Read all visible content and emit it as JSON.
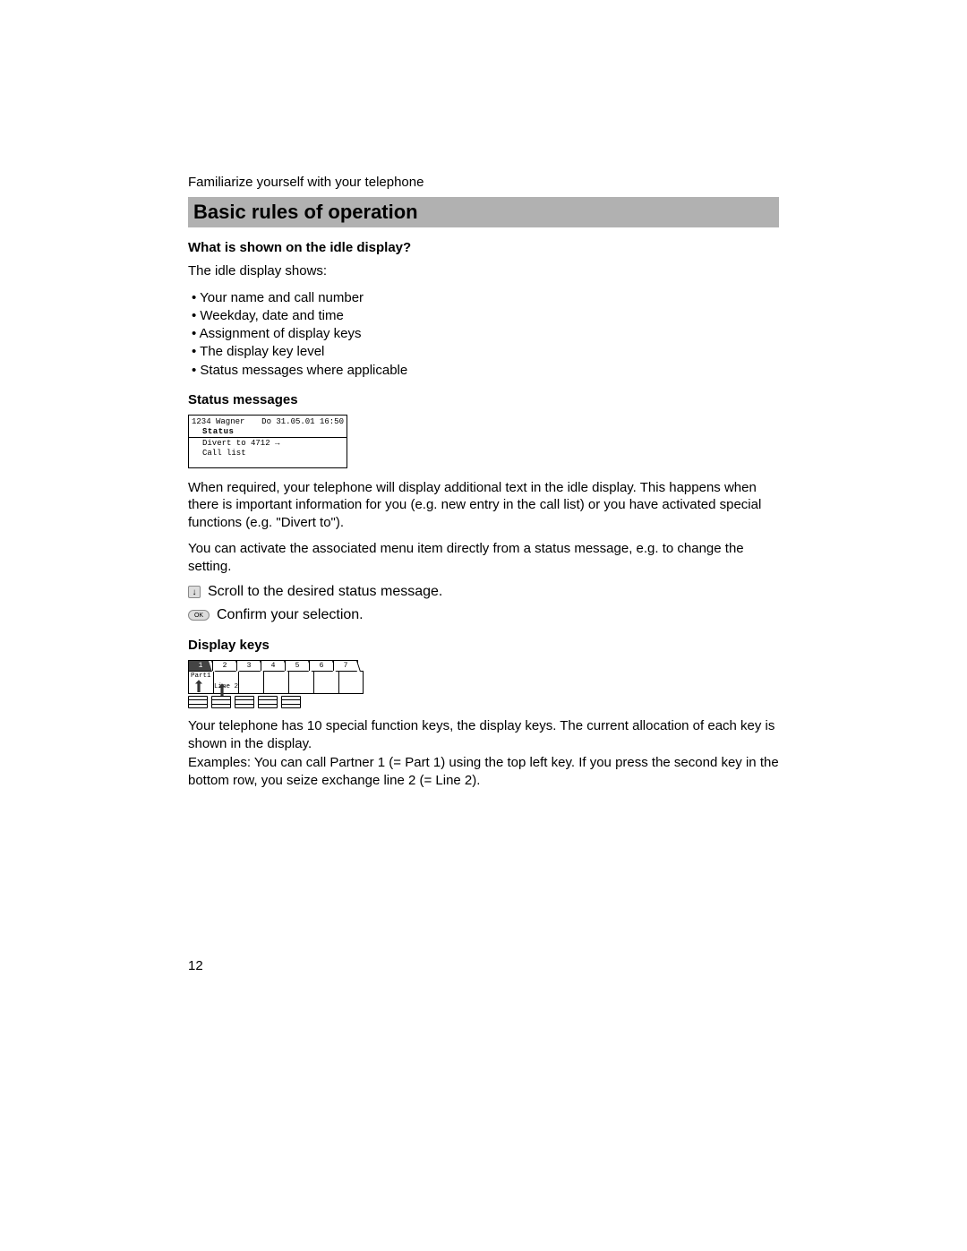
{
  "breadcrumb": "Familiarize yourself with your telephone",
  "section_title": "Basic rules of operation",
  "sub1": {
    "heading": "What is shown on the idle display?",
    "intro": "The idle display shows:",
    "bullets": [
      "Your name and call number",
      "Weekday, date and time",
      "Assignment of display keys",
      "The display key level",
      "Status messages where applicable"
    ]
  },
  "sub2": {
    "heading": "Status messages",
    "display": {
      "topleft": "1234 Wagner",
      "topright": "Do 31.05.01 16:50",
      "status_label": "Status",
      "msg1": "Divert to 4712 →",
      "msg2": "Call list"
    },
    "para1": "When required, your telephone will display additional text in the idle display. This happens when there is important information for you (e.g. new entry in the call list) or you have activated special functions (e.g. \"Divert to\").",
    "para2": "You can activate the associated menu item directly from a status message, e.g. to change the setting.",
    "step1": "Scroll to the desired status message.",
    "step2": "Confirm your selection."
  },
  "sub3": {
    "heading": "Display keys",
    "tabs": [
      "1",
      "2",
      "3",
      "4",
      "5",
      "6",
      "7"
    ],
    "screen_labels": {
      "part1": "Part1",
      "line2": "Line 2"
    },
    "para1": "Your telephone has 10 special function keys, the display keys. The current allocation of each key is shown in the display.",
    "para2": "Examples: You can call Partner 1 (= Part 1) using the top left key. If you press the second key in the bottom row, you seize exchange line 2 (= Line 2)."
  },
  "icons": {
    "down": "↓",
    "ok": "OK"
  },
  "page_number": "12"
}
